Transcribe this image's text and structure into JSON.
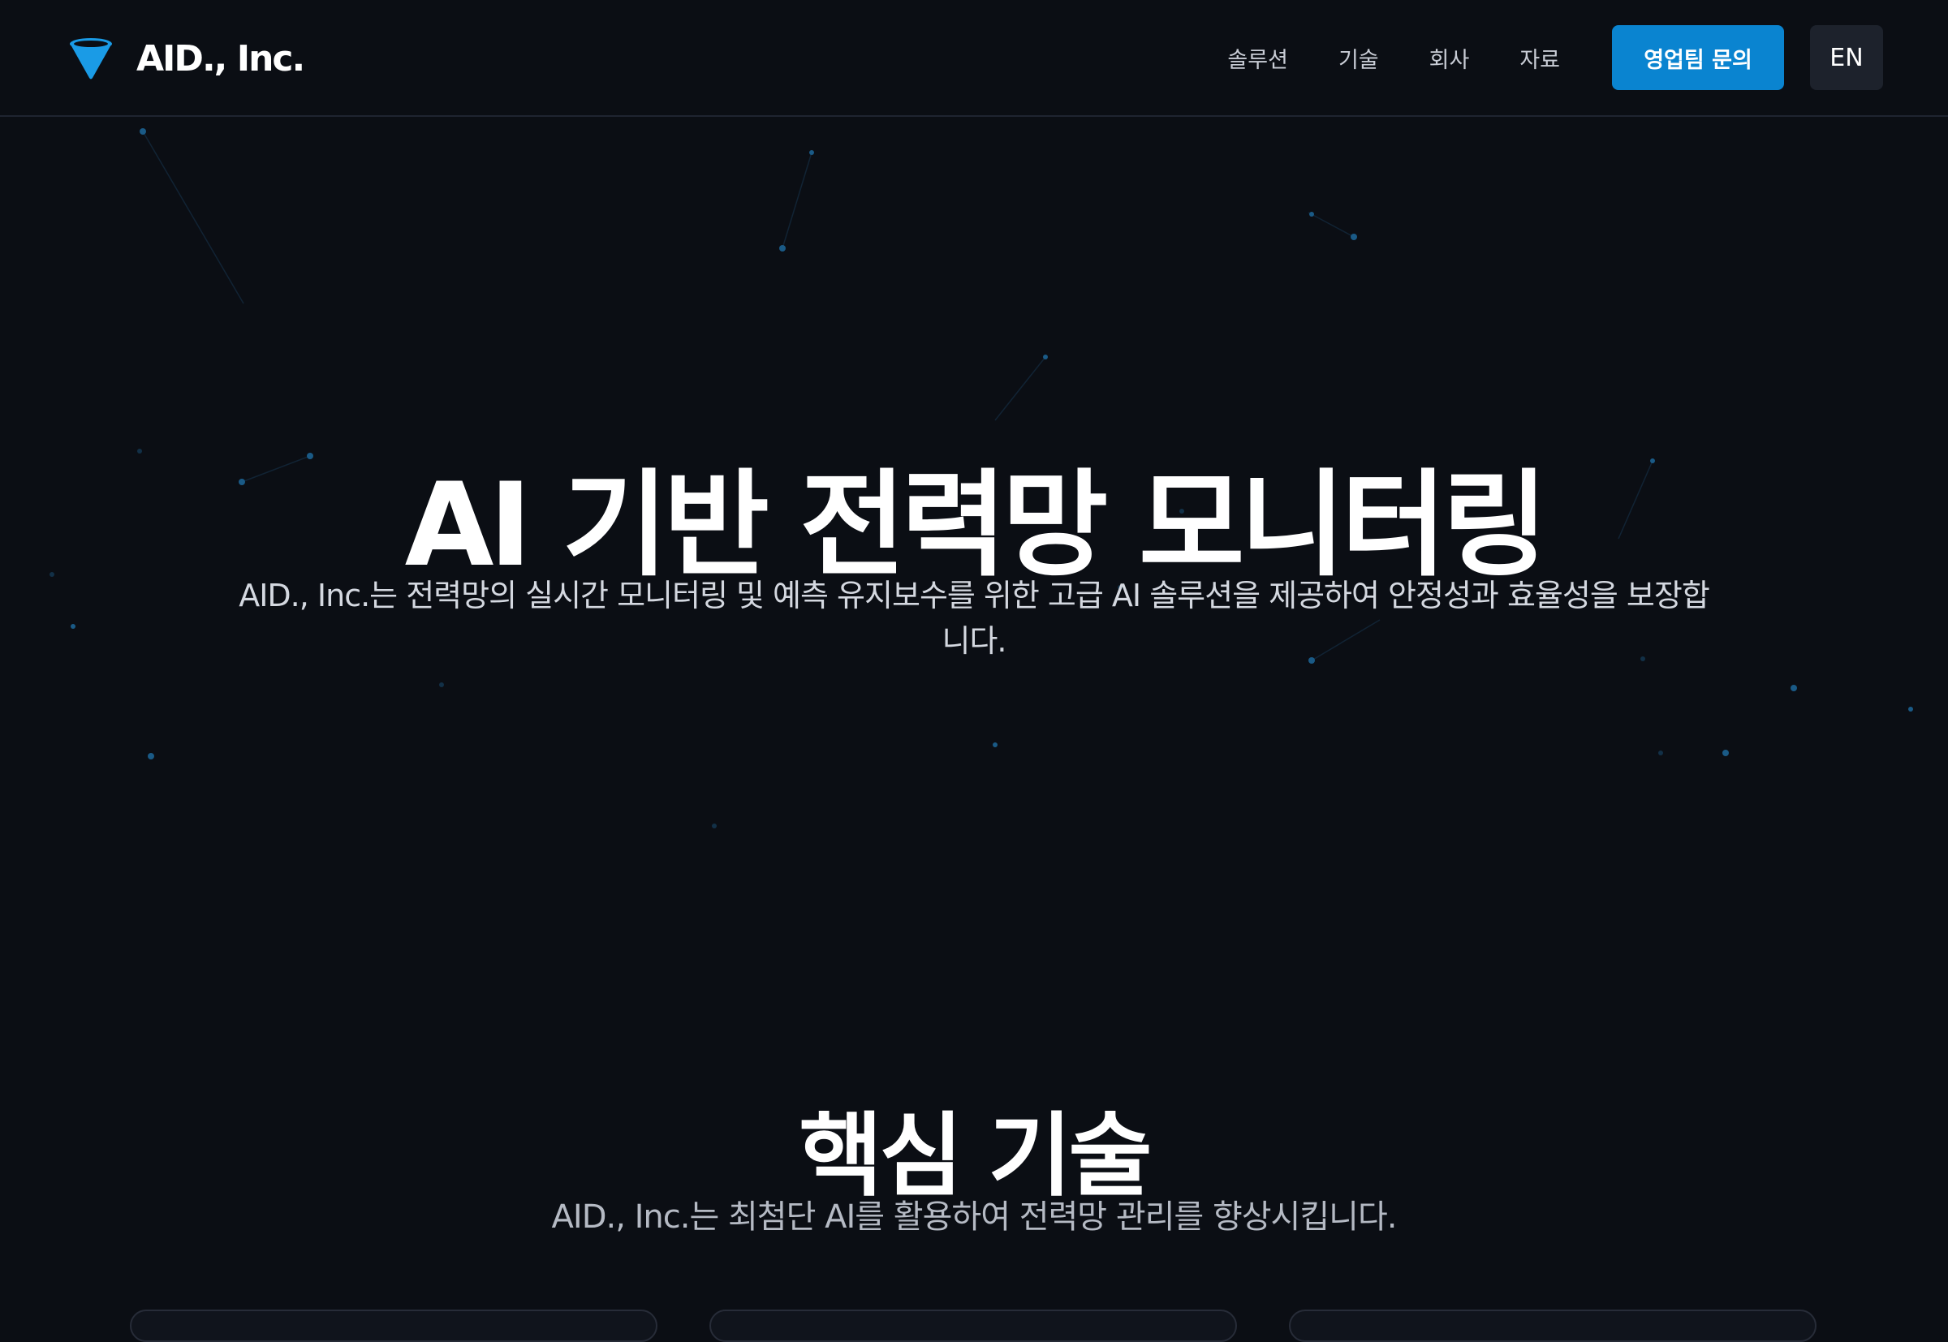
{
  "header": {
    "brand_name": "AID., Inc.",
    "logo_icon": "cone-logo-icon",
    "nav": [
      {
        "label": "솔루션"
      },
      {
        "label": "기술"
      },
      {
        "label": "회사"
      },
      {
        "label": "자료"
      }
    ],
    "cta_label": "영업팀 문의",
    "lang_label": "EN",
    "accent_color": "#0a84d0"
  },
  "hero": {
    "title": "AI 기반 전력망 모니터링",
    "subtitle": "AID., Inc.는 전력망의 실시간 모니터링 및 예측 유지보수를 위한 고급 AI 솔루션을 제공하여 안정성과 효율성을 보장합니다."
  },
  "tech": {
    "title": "핵심 기술",
    "subtitle": "AID., Inc.는 최첨단 AI를 활용하여 전력망 관리를 향상시킵니다."
  }
}
